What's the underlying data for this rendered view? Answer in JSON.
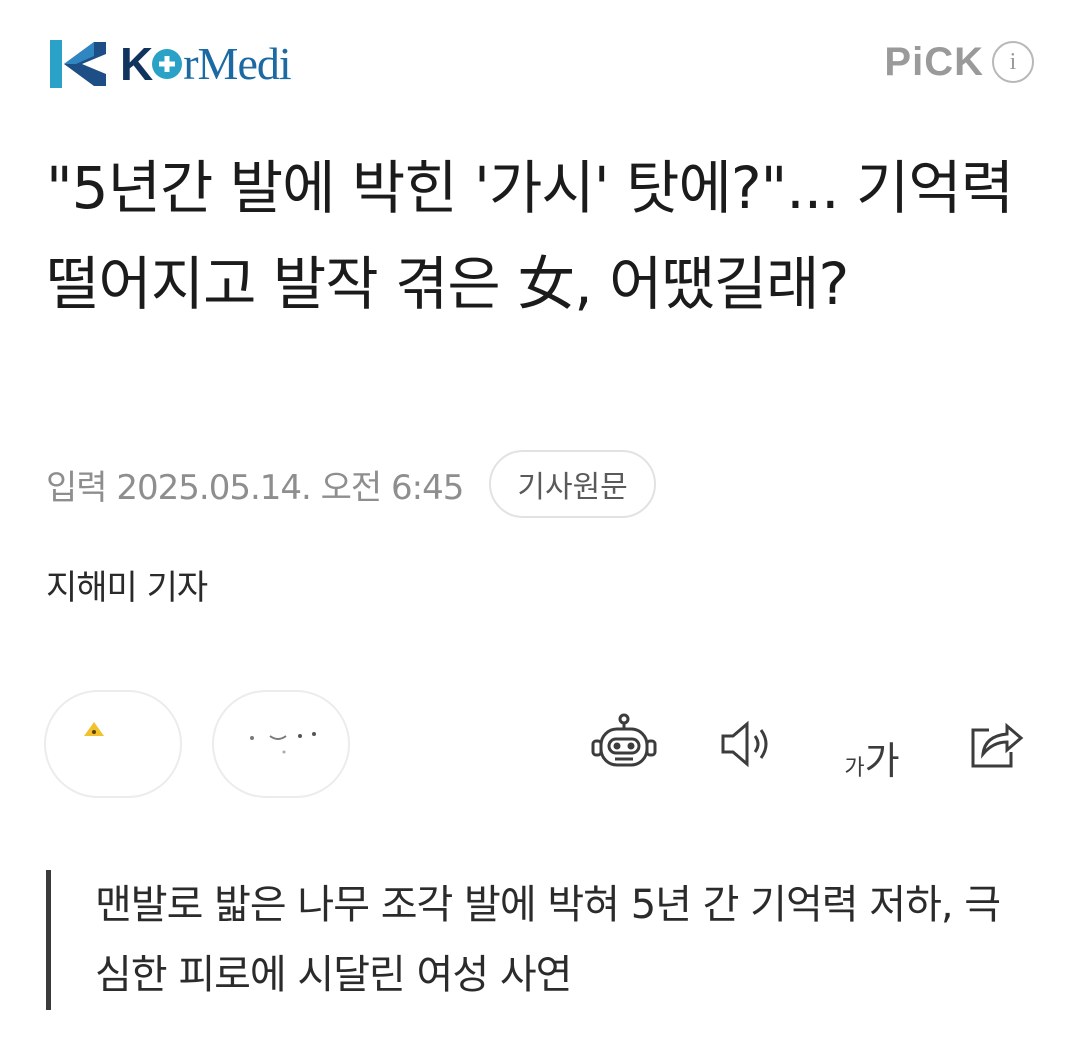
{
  "header": {
    "logo_text_part1": "K",
    "logo_text_part2": "rMedi",
    "pick_label": "PiCK",
    "info_symbol": "i"
  },
  "article": {
    "headline": "\"5년간 발에 박힌 '가시' 탓에?\"... 기억력 떨어지고 발작 겪은 女, 어땠길래?",
    "published": "입력 2025.05.14. 오전 6:45",
    "original_link_label": "기사원문",
    "byline": "지해미 기자",
    "summary": "맨발로 밟은 나무 조각 발에 박혀 5년 간 기억력 저하, 극심한 피로에 시달린 여성 사연"
  },
  "toolbar": {
    "font_size_small": "가",
    "font_size_large": "가",
    "icons": [
      "robot-summary-icon",
      "speaker-icon",
      "font-size-icon",
      "share-icon"
    ]
  },
  "colors": {
    "brand_navy": "#10345e",
    "brand_blue": "#1b6aa3",
    "brand_cyan": "#2aa1c7",
    "muted_text": "#8e8e8e"
  }
}
